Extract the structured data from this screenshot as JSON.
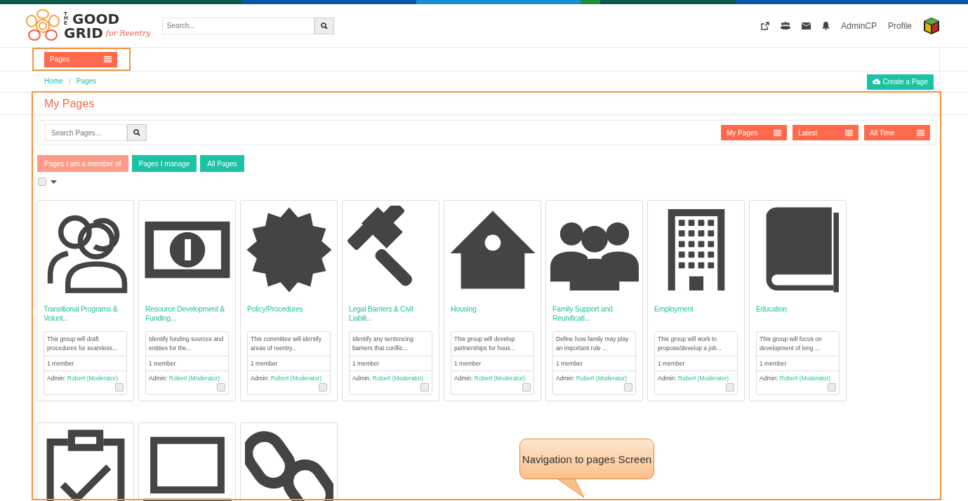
{
  "logo": {
    "line_1": "THE",
    "line_2": "GOOD",
    "line_3": "GRID",
    "tagline": "for Reentry"
  },
  "search": {
    "placeholder": "Search..."
  },
  "top_links": [
    "AdminCP",
    "Profile"
  ],
  "section_menu": {
    "label": "Pages"
  },
  "breadcrumb": {
    "items": [
      "Home",
      "Pages"
    ],
    "separator": "/"
  },
  "create_button": "Create a Page",
  "heading": "My Pages",
  "page_search": {
    "placeholder": "Search Pages..."
  },
  "sort_menus": [
    "My Pages",
    "Latest",
    "All Time"
  ],
  "filters": [
    {
      "label": "Pages I am a member of",
      "selected": true
    },
    {
      "label": "Pages I manage",
      "selected": false
    },
    {
      "label": "All Pages",
      "selected": false
    }
  ],
  "select_all": {
    "checked": false
  },
  "pages": [
    {
      "kind": "full",
      "title": "Transitional Programs & Volunt...",
      "description": "This group will draft procedures for seamless...",
      "members": "1 member",
      "admin_label": "Admin:",
      "admin": "Robert (Moderator)",
      "checked": false
    },
    {
      "kind": "full",
      "title": "Resource Development & Funding...",
      "description": "Identify funding sources and entities for the...",
      "members": "1 member",
      "admin_label": "Admin:",
      "admin": "Robert (Moderator)",
      "checked": false
    },
    {
      "kind": "full",
      "title": "Policy/Procedures",
      "description": "This committee will identify areas of reentry...",
      "members": "1 member",
      "admin_label": "Admin:",
      "admin": "Robert (Moderator)",
      "checked": false
    },
    {
      "kind": "full",
      "title": "Legal Barriers & Civil Liabili...",
      "description": "Identify any sentencing barriers that conflic...",
      "members": "1 member",
      "admin_label": "Admin:",
      "admin": "Robert (Moderator)",
      "checked": false
    },
    {
      "kind": "full",
      "title": "Housing",
      "description": "This group will develop partnerships for hous...",
      "members": "1 member",
      "admin_label": "Admin:",
      "admin": "Robert (Moderator)",
      "checked": false
    },
    {
      "kind": "full",
      "title": "Family Support and Reunificati...",
      "description": "Define how family may play an important role ...",
      "members": "1 member",
      "admin_label": "Admin:",
      "admin": "Robert (Moderator)",
      "checked": false
    },
    {
      "kind": "full",
      "title": "Employment",
      "description": "This group will work to propose/develop a job...",
      "members": "1 member",
      "admin_label": "Admin:",
      "admin": "Robert (Moderator)",
      "checked": false
    },
    {
      "kind": "full",
      "title": "Education",
      "description": "This group will focus on development of long ...",
      "members": "1 member",
      "admin_label": "Admin:",
      "admin": "Robert (Moderator)",
      "checked": false
    },
    {
      "kind": "cut"
    },
    {
      "kind": "cut"
    },
    {
      "kind": "cut"
    }
  ],
  "callout": "Navigation to pages Screen"
}
